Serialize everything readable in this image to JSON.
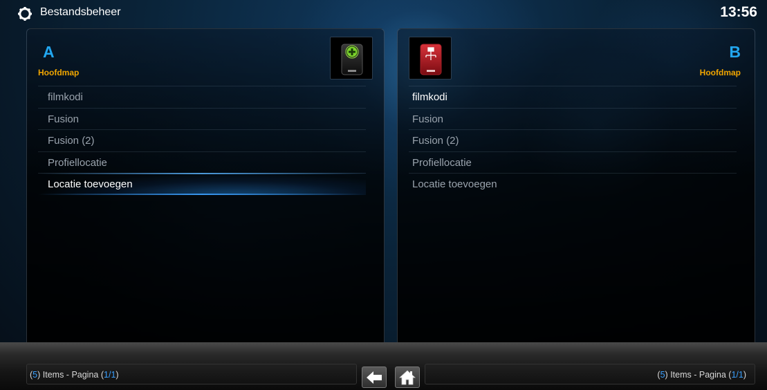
{
  "app": {
    "title": "Bestandsbeheer",
    "clock": "13:56"
  },
  "panel_a": {
    "letter": "A",
    "subtitle": "Hoofdmap",
    "icon": "drive-add-icon",
    "items": [
      {
        "label": "filmkodi"
      },
      {
        "label": "Fusion"
      },
      {
        "label": "Fusion (2)"
      },
      {
        "label": "Profiellocatie"
      },
      {
        "label": "Locatie toevoegen",
        "focused": true
      }
    ],
    "footer": {
      "count": "5",
      "items_label": " Items - Pagina ",
      "page": "1/1"
    }
  },
  "panel_b": {
    "letter": "B",
    "subtitle": "Hoofdmap",
    "icon": "network-drive-icon",
    "items": [
      {
        "label": "filmkodi"
      },
      {
        "label": "Fusion"
      },
      {
        "label": "Fusion (2)"
      },
      {
        "label": "Profiellocatie"
      },
      {
        "label": "Locatie toevoegen"
      }
    ],
    "footer": {
      "count": "5",
      "items_label": " Items - Pagina ",
      "page": "1/1"
    }
  },
  "nav": {
    "back_icon": "arrow-left-icon",
    "home_icon": "home-icon"
  },
  "colors": {
    "accent_blue": "#22a7f0",
    "subtitle_orange": "#f0a500",
    "background": "#0a2338"
  }
}
